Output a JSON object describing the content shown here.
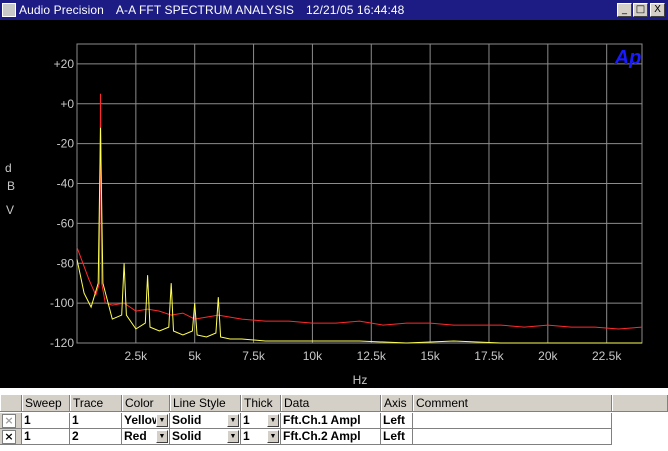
{
  "window": {
    "app_name": "Audio Precision",
    "doc_title": "A-A FFT SPECTRUM ANALYSIS",
    "timestamp": "12/21/05 16:44:48",
    "buttons": {
      "minimize": "_",
      "maximize": "□",
      "close": "X"
    }
  },
  "plot": {
    "logo": "Ap",
    "xlabel": "Hz",
    "ylabel_chars": [
      "d",
      "B",
      "V"
    ],
    "y_ticks": [
      "+20",
      "+0",
      "-20",
      "-40",
      "-60",
      "-80",
      "-100",
      "-120"
    ],
    "x_ticks": [
      "2.5k",
      "5k",
      "7.5k",
      "10k",
      "12.5k",
      "15k",
      "17.5k",
      "20k",
      "22.5k"
    ]
  },
  "chart_data": {
    "type": "line",
    "xlabel": "Hz",
    "ylabel": "dBV",
    "xlim": [
      0,
      24000
    ],
    "ylim": [
      -120,
      30
    ],
    "grid": true,
    "series": [
      {
        "color": "#ff2a2a",
        "x": [
          0,
          500,
          800,
          950,
          1000,
          1050,
          1200,
          1500,
          2000,
          2500,
          3000,
          3500,
          4000,
          4500,
          5000,
          5500,
          6000,
          7000,
          8000,
          9000,
          10000,
          11000,
          12000,
          13000,
          14000,
          15000,
          16000,
          17000,
          18000,
          19000,
          20000,
          21000,
          22000,
          23000,
          24000
        ],
        "y": [
          -72,
          -88,
          -96,
          -90,
          5,
          -90,
          -100,
          -101,
          -100,
          -104,
          -103,
          -104,
          -106,
          -105,
          -108,
          -107,
          -106,
          -108,
          -109,
          -109,
          -110,
          -110,
          -109,
          -111,
          -110,
          -110,
          -111,
          -111,
          -111,
          -112,
          -111,
          -112,
          -112,
          -113,
          -112
        ]
      },
      {
        "color": "#ffff55",
        "x": [
          0,
          300,
          600,
          900,
          1000,
          1100,
          1500,
          1900,
          2000,
          2100,
          2500,
          2900,
          3000,
          3100,
          3500,
          3900,
          4000,
          4100,
          4500,
          4900,
          5000,
          5100,
          5500,
          5900,
          6000,
          6100,
          6500,
          7000,
          8000,
          9000,
          10000,
          12000,
          14000,
          16000,
          18000,
          20000,
          22000,
          24000
        ],
        "y": [
          -78,
          -95,
          -102,
          -90,
          -12,
          -90,
          -108,
          -106,
          -80,
          -106,
          -113,
          -110,
          -86,
          -112,
          -114,
          -112,
          -90,
          -114,
          -116,
          -114,
          -100,
          -116,
          -117,
          -115,
          -97,
          -117,
          -118,
          -118,
          -119,
          -119,
          -119,
          -119,
          -120,
          -119,
          -120,
          -120,
          -120,
          -120
        ]
      }
    ]
  },
  "table": {
    "columns": [
      "Sweep",
      "Trace",
      "Color",
      "Line Style",
      "Thick",
      "Data",
      "Axis",
      "Comment"
    ],
    "rows": [
      {
        "checked": false,
        "check_mark": "×",
        "sweep": "1",
        "trace": "1",
        "color": "Yellow",
        "line_style": "Solid",
        "thick": "1",
        "data": "Fft.Ch.1 Ampl",
        "axis": "Left",
        "comment": ""
      },
      {
        "checked": true,
        "check_mark": "×",
        "sweep": "1",
        "trace": "2",
        "color": "Red",
        "line_style": "Solid",
        "thick": "1",
        "data": "Fft.Ch.2 Ampl",
        "axis": "Left",
        "comment": ""
      }
    ]
  }
}
